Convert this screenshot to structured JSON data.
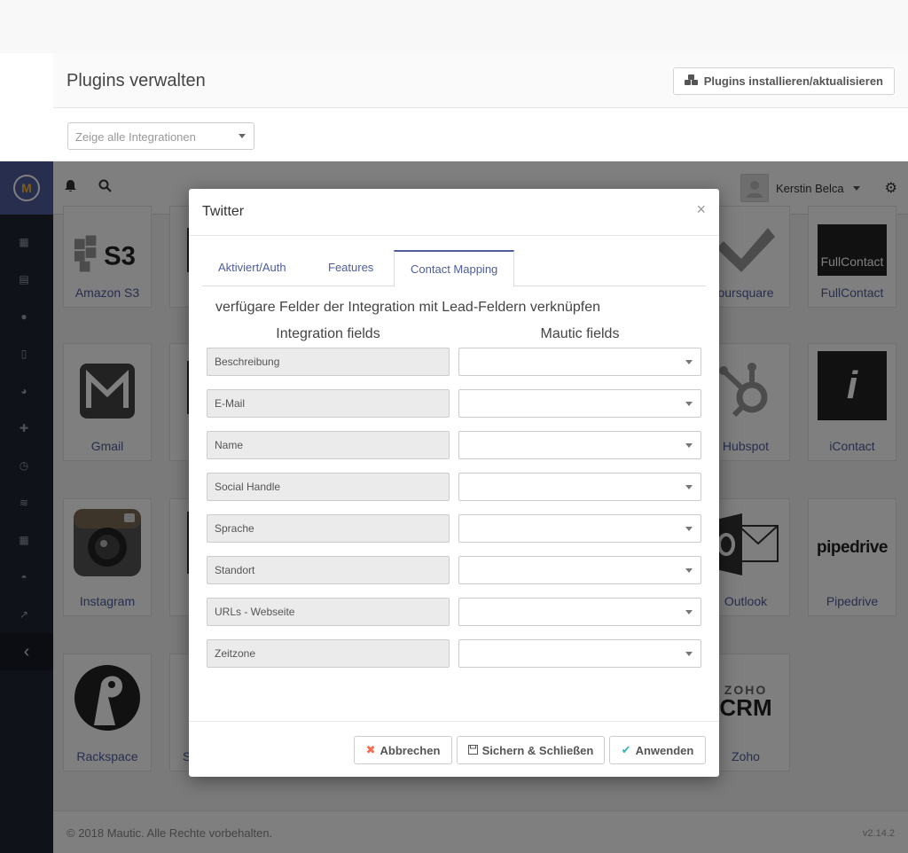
{
  "page": {
    "title": "Plugins verwalten",
    "install_button": "Plugins installieren/aktualisieren",
    "filter_placeholder": "Zeige alle Integrationen"
  },
  "topbar": {
    "user_name": "Kerstin Belca"
  },
  "tiles": [
    {
      "name": "Amazon S3",
      "logo": "S3"
    },
    {
      "name": "oursquare",
      "logo": "foursquare-logo"
    },
    {
      "name": "FullContact",
      "logo": "FullContact"
    },
    {
      "name": "Gmail",
      "logo": "gmail-logo"
    },
    {
      "name": "Hubspot",
      "logo": "hubspot-logo"
    },
    {
      "name": "iContact",
      "logo": "icontact-logo"
    },
    {
      "name": "Instagram",
      "logo": "instagram-logo"
    },
    {
      "name": "Outlook",
      "logo": "outlook-logo"
    },
    {
      "name": "Pipedrive",
      "logo": "pipedrive"
    },
    {
      "name": "Rackspace",
      "logo": "rackspace-logo"
    },
    {
      "name": "Zoho",
      "logo": "ZOHO CRM"
    },
    {
      "name": "S",
      "logo": ""
    }
  ],
  "footer": {
    "copyright": "© 2018 Mautic. Alle Rechte vorbehalten.",
    "version": "v2.14.2"
  },
  "modal": {
    "title": "Twitter",
    "close": "×",
    "tabs": [
      "Aktiviert/Auth",
      "Features",
      "Contact Mapping"
    ],
    "active_tab": "Contact Mapping",
    "section_title": "verfügare Felder der Integration mit Lead-Feldern verknüpfen",
    "col_integration": "Integration fields",
    "col_mautic": "Mautic fields",
    "fields": [
      "Beschreibung",
      "E-Mail",
      "Name",
      "Social Handle",
      "Sprache",
      "Standort",
      "URLs - Webseite",
      "Zeitzone"
    ],
    "buttons": {
      "cancel": "Abbrechen",
      "save_close": "Sichern & Schließen",
      "apply": "Anwenden"
    }
  },
  "colors": {
    "brand": "#4e5d9d",
    "sidebar": "#1f2433",
    "accent_orange": "#fdb933",
    "cancel_red": "#f86b4f",
    "apply_teal": "#35b4b9"
  }
}
